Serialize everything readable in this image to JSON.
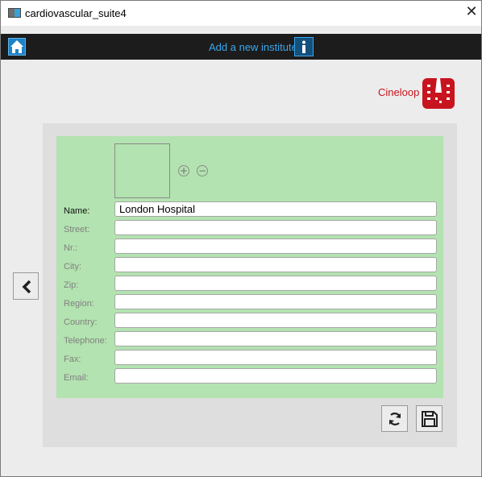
{
  "window": {
    "title": "cardiovascular_suite4",
    "close_glyph": "✕"
  },
  "navbar": {
    "home_icon": "home-icon",
    "title": "Add a new institute",
    "info_icon": "info-icon"
  },
  "brand": {
    "name": "Cineloop",
    "color": "#c8141e"
  },
  "photo": {
    "add_glyph": "+",
    "remove_glyph": "−"
  },
  "form": {
    "fields": [
      {
        "label": "Name:",
        "value": "London Hospital",
        "active": true
      },
      {
        "label": "Street:",
        "value": ""
      },
      {
        "label": "Nr.:",
        "value": ""
      },
      {
        "label": "City:",
        "value": ""
      },
      {
        "label": "Zip:",
        "value": ""
      },
      {
        "label": "Region:",
        "value": ""
      },
      {
        "label": "Country:",
        "value": ""
      },
      {
        "label": "Telephone:",
        "value": ""
      },
      {
        "label": "Fax:",
        "value": ""
      },
      {
        "label": "Email:",
        "value": ""
      }
    ]
  },
  "actions": {
    "back_icon": "chevron-left-icon",
    "refresh_icon": "refresh-icon",
    "save_icon": "save-icon"
  },
  "colors": {
    "form_bg": "#b3e3b0",
    "nav_bg": "#1c1c1c",
    "accent": "#3aa8ee"
  }
}
